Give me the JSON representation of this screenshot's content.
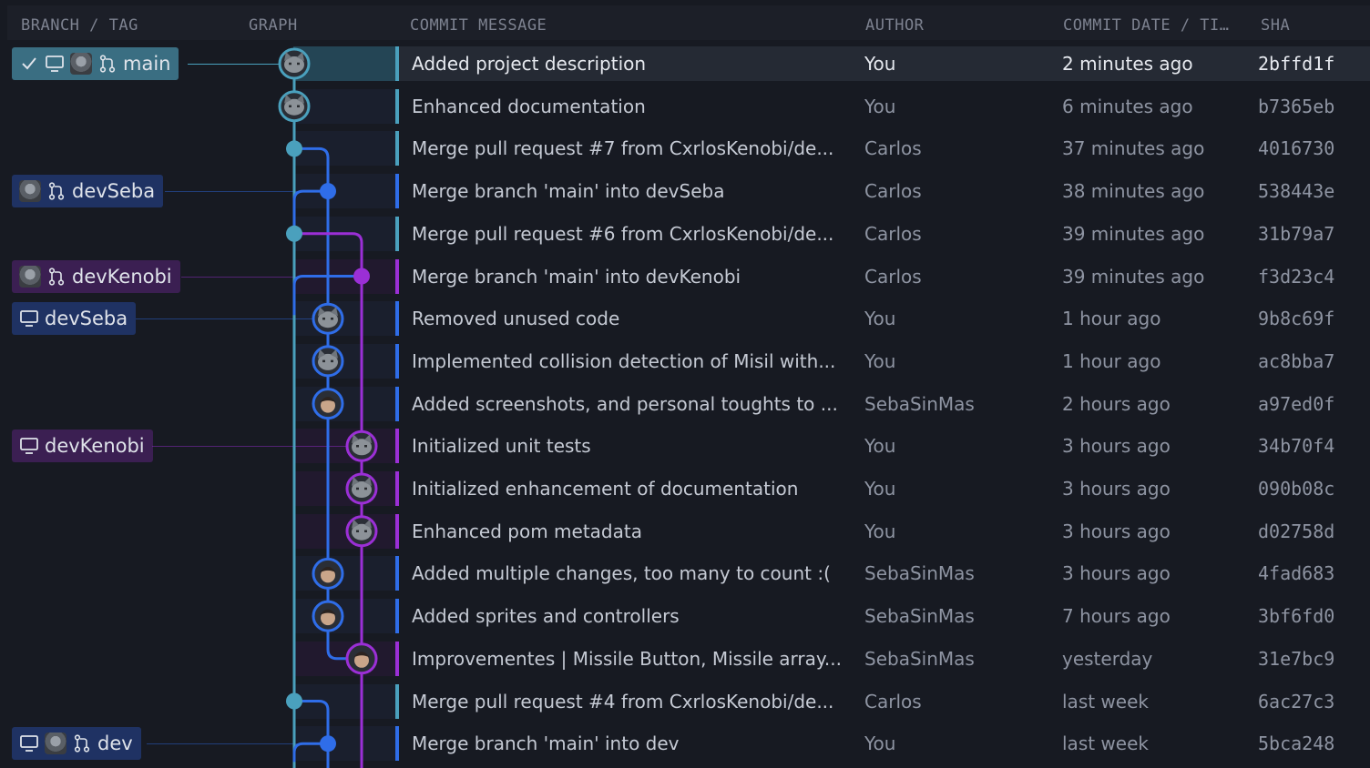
{
  "colors": {
    "lane_teal": "#4aa0bd",
    "lane_blue": "#2f6de8",
    "lane_purple": "#9b2fd6"
  },
  "columns": {
    "branch": "BRANCH / TAG",
    "graph": "GRAPH",
    "message": "COMMIT MESSAGE",
    "author": "AUTHOR",
    "date": "COMMIT DATE / TI…",
    "sha": "SHA"
  },
  "refs": [
    {
      "label": "main",
      "icons": [
        "check-icon",
        "monitor-icon",
        "avatar",
        "branch-icon"
      ],
      "color": "#3a6e82"
    },
    {
      "label": "devSeba",
      "icons": [
        "avatar",
        "branch-icon"
      ],
      "color": "#1f3263"
    },
    {
      "label": "devKenobi",
      "icons": [
        "avatar",
        "branch-icon"
      ],
      "color": "#3b1f52"
    },
    {
      "label": "devSeba",
      "icons": [
        "monitor-icon"
      ],
      "color": "#1f3263"
    },
    {
      "label": "devKenobi",
      "icons": [
        "monitor-icon"
      ],
      "color": "#3b1f52"
    },
    {
      "label": "dev",
      "icons": [
        "monitor-icon",
        "avatar",
        "branch-icon"
      ],
      "color": "#1f3263"
    }
  ],
  "commits": [
    {
      "message": "Added project description",
      "author": "You",
      "date": "2 minutes ago",
      "sha": "2bffd1f"
    },
    {
      "message": "Enhanced documentation",
      "author": "You",
      "date": "6 minutes ago",
      "sha": "b7365eb"
    },
    {
      "message": "Merge pull request #7 from CxrlosKenobi/de...",
      "author": "Carlos",
      "date": "37 minutes ago",
      "sha": "4016730"
    },
    {
      "message": "Merge branch 'main' into devSeba",
      "author": "Carlos",
      "date": "38 minutes ago",
      "sha": "538443e"
    },
    {
      "message": "Merge pull request #6 from CxrlosKenobi/de...",
      "author": "Carlos",
      "date": "39 minutes ago",
      "sha": "31b79a7"
    },
    {
      "message": "Merge branch 'main' into devKenobi",
      "author": "Carlos",
      "date": "39 minutes ago",
      "sha": "f3d23c4"
    },
    {
      "message": "Removed unused code",
      "author": "You",
      "date": "1 hour ago",
      "sha": "9b8c69f"
    },
    {
      "message": "Implemented collision detection of Misil with...",
      "author": "You",
      "date": "1 hour ago",
      "sha": "ac8bba7"
    },
    {
      "message": "Added screenshots, and personal toughts to ...",
      "author": "SebaSinMas",
      "date": "2 hours ago",
      "sha": "a97ed0f"
    },
    {
      "message": "Initialized unit tests",
      "author": "You",
      "date": "3 hours ago",
      "sha": "34b70f4"
    },
    {
      "message": "Initialized enhancement of documentation",
      "author": "You",
      "date": "3 hours ago",
      "sha": "090b08c"
    },
    {
      "message": "Enhanced pom metadata",
      "author": "You",
      "date": "3 hours ago",
      "sha": "d02758d"
    },
    {
      "message": "Added multiple changes, too many to count :(",
      "author": "SebaSinMas",
      "date": "3 hours ago",
      "sha": "4fad683"
    },
    {
      "message": "Added sprites and controllers",
      "author": "SebaSinMas",
      "date": "7 hours ago",
      "sha": "3bf6fd0"
    },
    {
      "message": "Improvementes | Missile Button, Missile array...",
      "author": "SebaSinMas",
      "date": "yesterday",
      "sha": "31e7bc9"
    },
    {
      "message": "Merge pull request #4 from CxrlosKenobi/de...",
      "author": "Carlos",
      "date": "last week",
      "sha": "6ac27c3"
    },
    {
      "message": "Merge branch 'main' into dev",
      "author": "You",
      "date": "last week",
      "sha": "5bca248"
    }
  ]
}
